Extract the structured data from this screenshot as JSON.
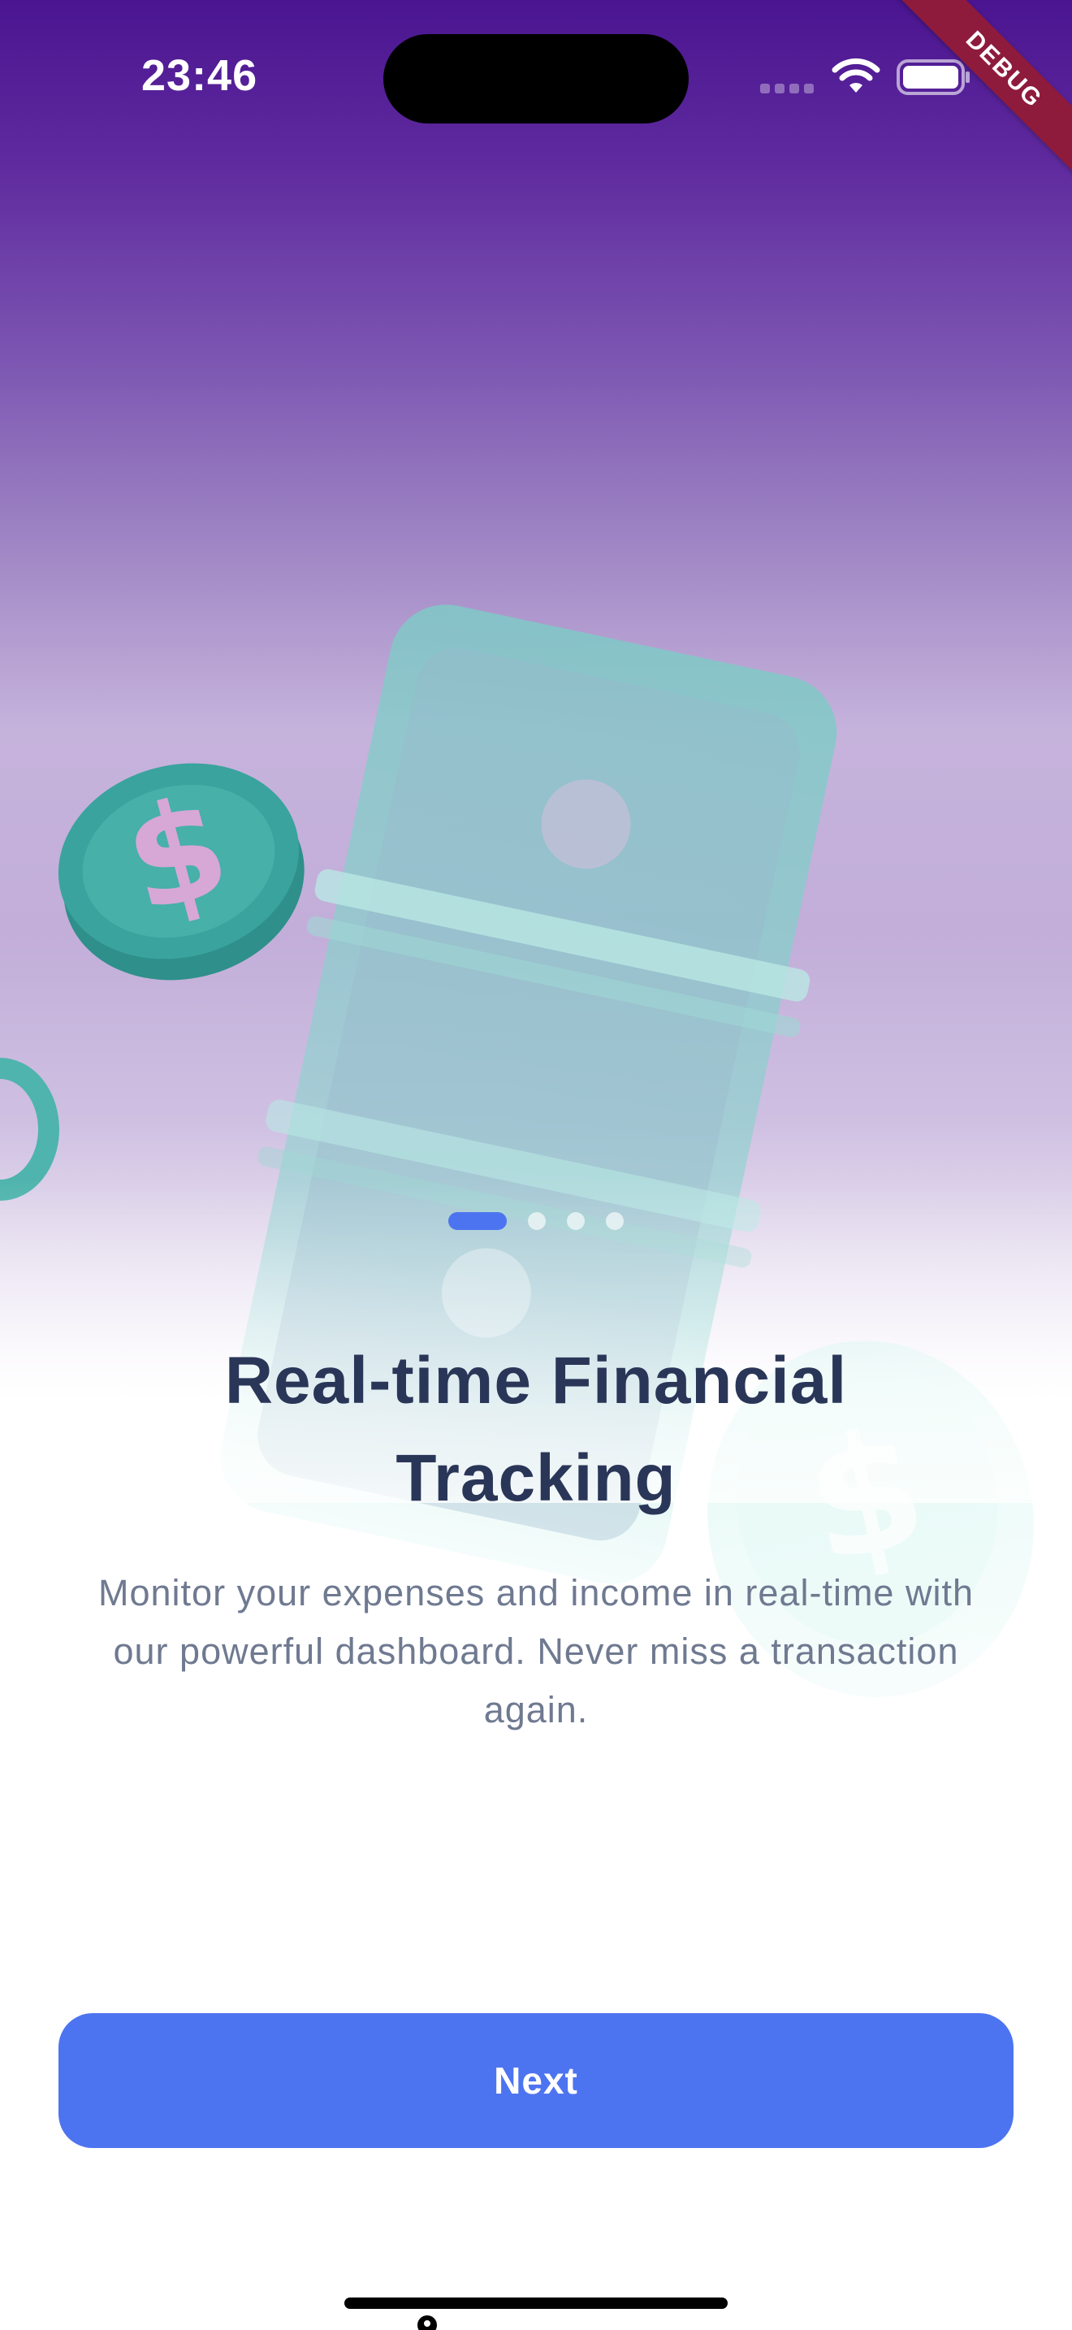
{
  "status_bar": {
    "time": "23:46",
    "icons": [
      "signal-dots-icon",
      "wifi-icon",
      "battery-icon"
    ]
  },
  "debug_banner": {
    "label": "DEBUG"
  },
  "illustration": {
    "icon": "money-stack-with-coins-icon",
    "colors": {
      "money": "#6fc8c4",
      "coin": "#3aa39d",
      "coin_symbol": "#d7a7d6"
    }
  },
  "page_indicator": {
    "total": 4,
    "active_index": 0
  },
  "onboarding": {
    "title": "Real-time Financial Tracking",
    "description": "Monitor your expenses and income in real-time with our powerful dashboard. Never miss a transaction again."
  },
  "actions": {
    "next_label": "Next"
  },
  "colors": {
    "accent": "#4d74f0",
    "title": "#2a3658",
    "description": "#6f7a91",
    "gradient_top": "#4a1590",
    "debug_ribbon": "#8e1b3c"
  }
}
